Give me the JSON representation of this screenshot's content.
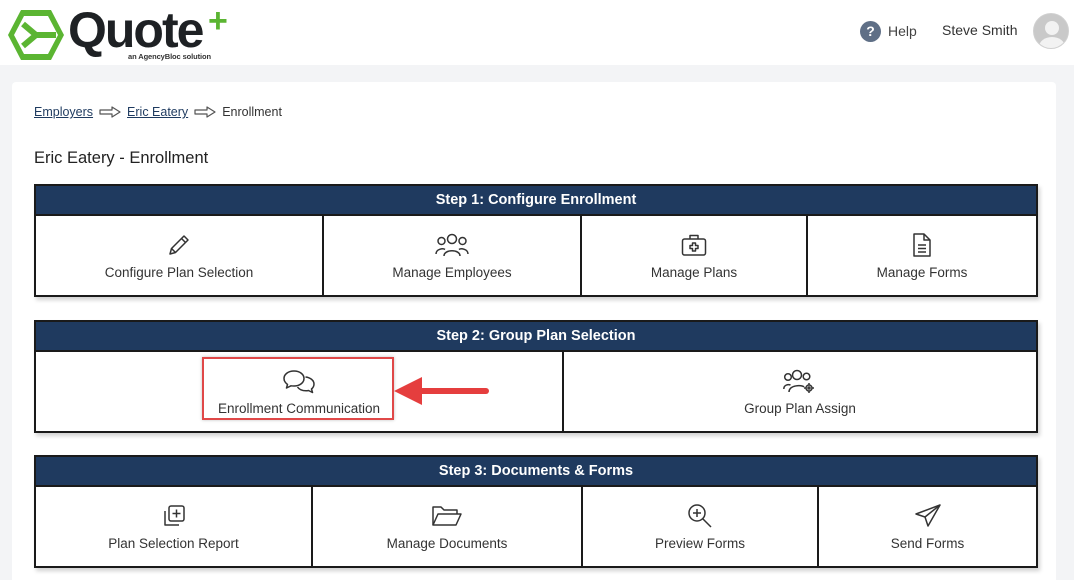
{
  "header": {
    "logo_word": "Quote",
    "logo_plus": "+",
    "logo_sub": "an AgencyBloc solution",
    "help_label": "Help",
    "user_name": "Steve Smith",
    "icons": {
      "help": "question-circle-icon",
      "avatar": "user-avatar-icon"
    }
  },
  "breadcrumb": {
    "items": [
      "Employers",
      "Eric Eatery",
      "Enrollment"
    ]
  },
  "page_title": "Eric Eatery - Enrollment",
  "steps": [
    {
      "title": "Step 1: Configure Enrollment",
      "items": [
        {
          "label": "Configure Plan Selection",
          "icon": "pencil-icon"
        },
        {
          "label": "Manage Employees",
          "icon": "users-icon"
        },
        {
          "label": "Manage Plans",
          "icon": "medical-kit-icon"
        },
        {
          "label": "Manage Forms",
          "icon": "document-icon"
        }
      ]
    },
    {
      "title": "Step 2: Group Plan Selection",
      "items": [
        {
          "label": "Enrollment Communication",
          "icon": "chat-bubbles-icon"
        },
        {
          "label": "Group Plan Assign",
          "icon": "users-gear-icon"
        }
      ]
    },
    {
      "title": "Step 3: Documents & Forms",
      "items": [
        {
          "label": "Plan Selection Report",
          "icon": "copy-plus-icon"
        },
        {
          "label": "Manage Documents",
          "icon": "folder-open-icon"
        },
        {
          "label": "Preview Forms",
          "icon": "zoom-in-icon"
        },
        {
          "label": "Send Forms",
          "icon": "paper-plane-icon"
        }
      ]
    }
  ],
  "colors": {
    "step_header": "#1f3a5f",
    "highlight": "#e04848",
    "logo_green": "#5bb532"
  }
}
